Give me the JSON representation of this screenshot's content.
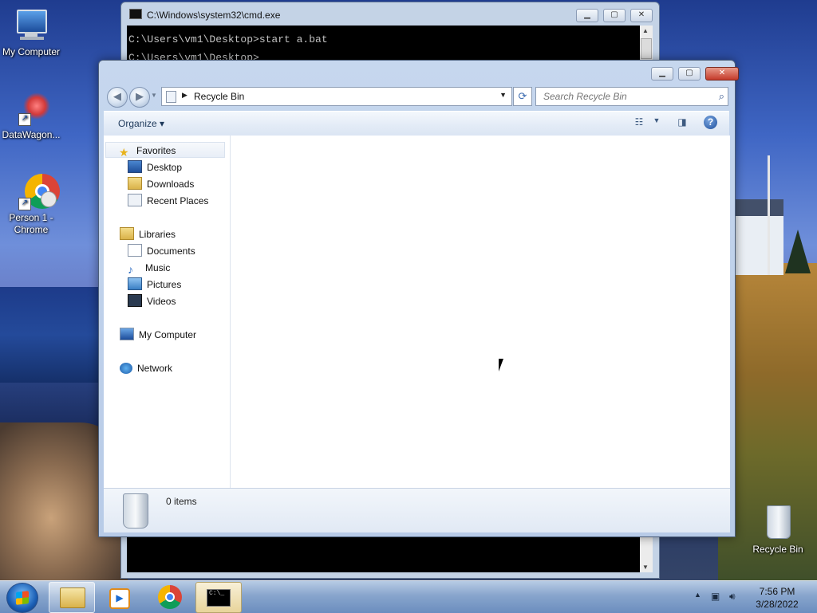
{
  "desktop": {
    "icons": [
      {
        "label": "My Computer"
      },
      {
        "label": "DataWagon..."
      },
      {
        "label": "Person 1 - Chrome"
      },
      {
        "label": "Recycle Bin"
      }
    ]
  },
  "cmd": {
    "title": "C:\\Windows\\system32\\cmd.exe",
    "lines": [
      "C:\\Users\\vm1\\Desktop>start a.bat",
      "C:\\Users\\vm1\\Desktop>"
    ]
  },
  "explorer": {
    "breadcrumb": "Recycle Bin",
    "search_placeholder": "Search Recycle Bin",
    "organize_label": "Organize",
    "nav": {
      "favorites": {
        "label": "Favorites",
        "items": [
          "Desktop",
          "Downloads",
          "Recent Places"
        ]
      },
      "libraries": {
        "label": "Libraries",
        "items": [
          "Documents",
          "Music",
          "Pictures",
          "Videos"
        ]
      },
      "computer": "My Computer",
      "network": "Network"
    },
    "details": {
      "item_count": "0 items"
    }
  },
  "taskbar": {
    "time": "7:56 PM",
    "date": "3/28/2022"
  },
  "colors": {
    "accent": "#1e395b",
    "window_frame": "#c6d7ee",
    "console_bg": "#000000"
  }
}
